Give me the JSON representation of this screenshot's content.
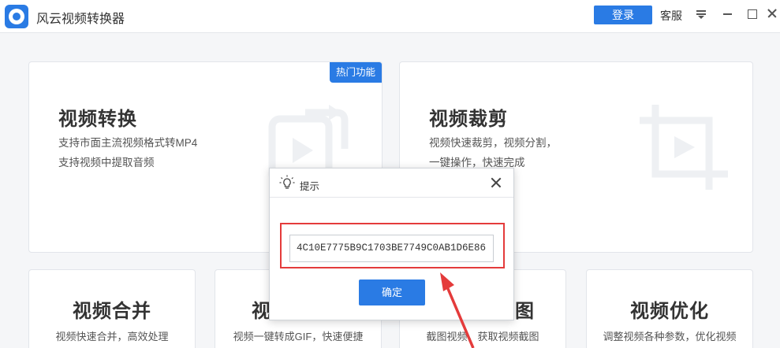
{
  "app": {
    "title": "风云视频转换器",
    "login_label": "登录",
    "service_label": "客服"
  },
  "cards": {
    "convert": {
      "title": "视频转换",
      "desc": [
        "支持市面主流视频格式转MP4",
        "支持视频中提取音频"
      ],
      "badge": "热门功能"
    },
    "crop": {
      "title": "视频裁剪",
      "desc": [
        "视频快速裁剪，视频分割，",
        "一键操作，快速完成"
      ]
    },
    "merge": {
      "title": "视频合并",
      "desc": "视频快速合并，高效处理"
    },
    "gif": {
      "title_visible": "视",
      "desc": "视频一键转成GIF，快速便捷"
    },
    "screenshot": {
      "title_visible": "图",
      "desc": "截图视频，获取视频截图"
    },
    "optimize": {
      "title": "视频优化",
      "desc": "调整视频各种参数，优化视频"
    }
  },
  "dialog": {
    "title": "提示",
    "code": "4C10E7775B9C1703BE7749C0AB1D6E86",
    "ok_label": "确定"
  },
  "colors": {
    "accent": "#2a7be4",
    "highlight": "#e43b3b"
  }
}
